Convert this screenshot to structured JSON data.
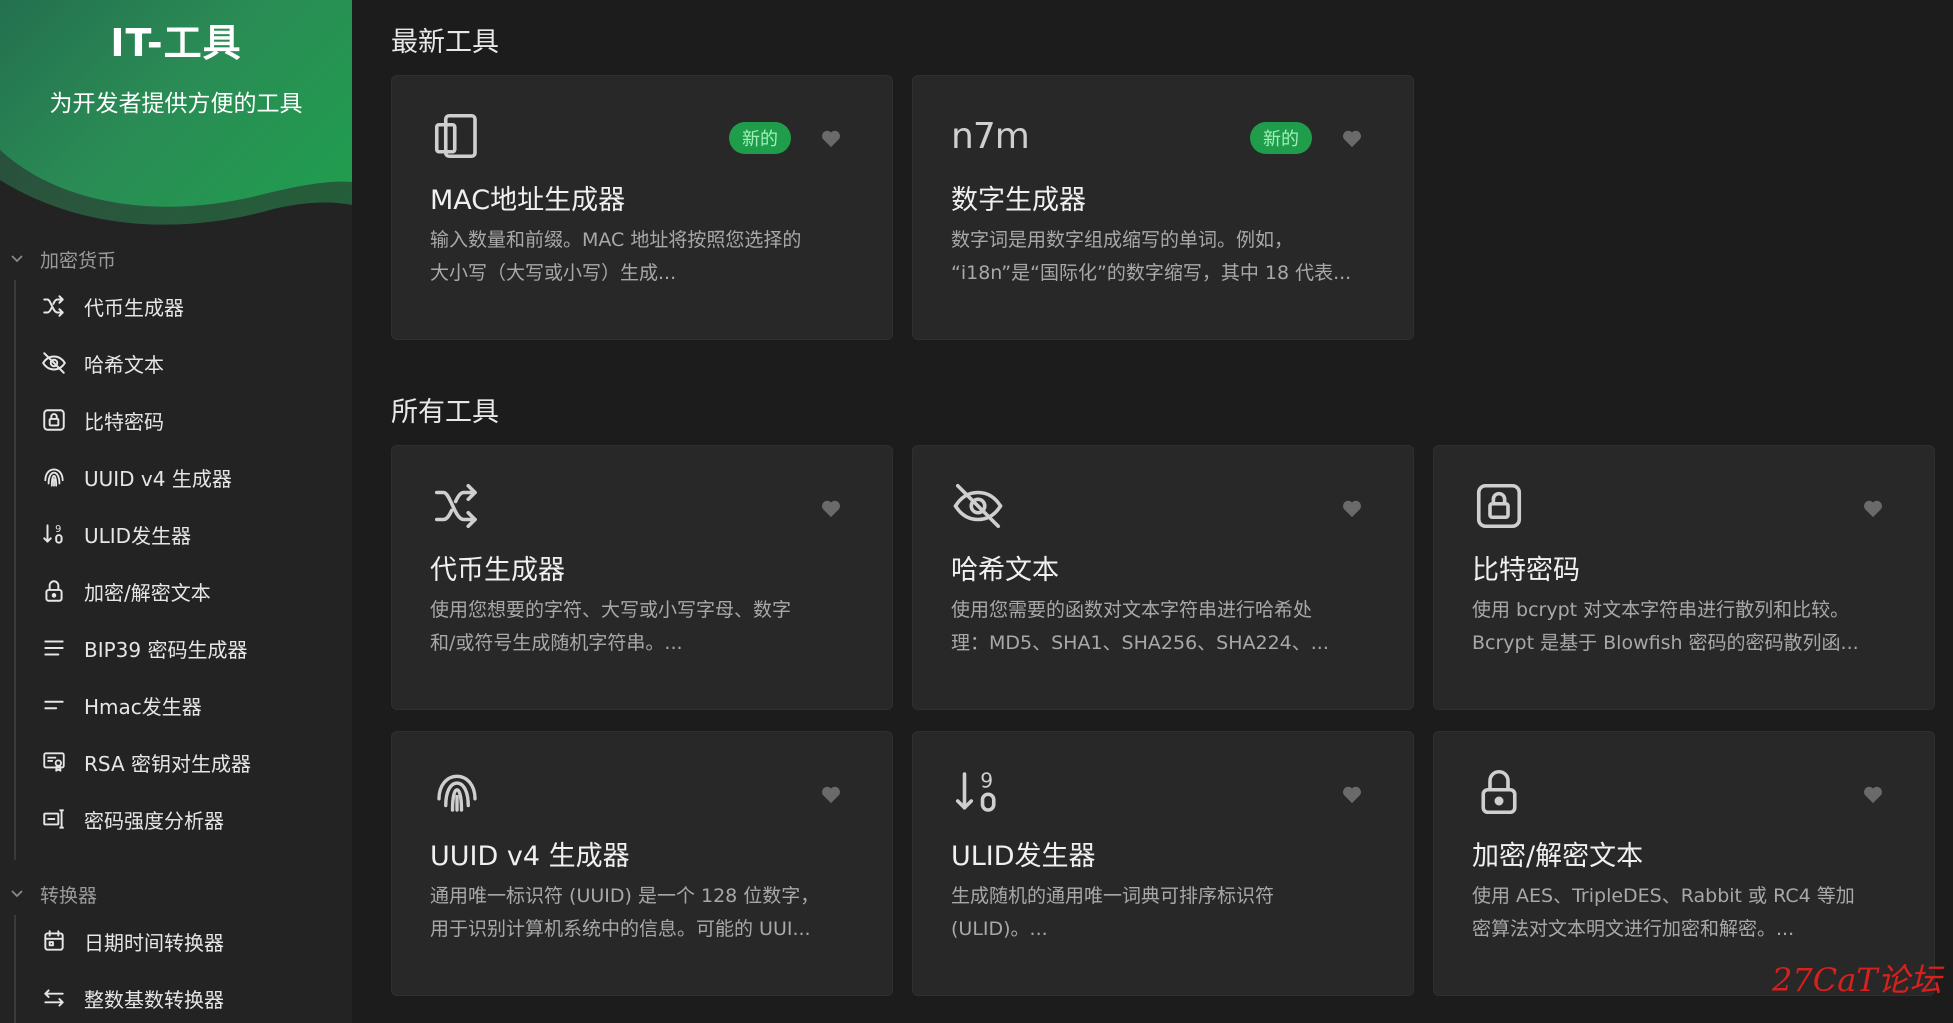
{
  "app": {
    "title": "IT-工具",
    "subtitle": "为开发者提供方便的工具"
  },
  "sidebar": {
    "groups": [
      {
        "label": "加密货币",
        "items": [
          {
            "label": "代币生成器",
            "icon": "shuffle-icon"
          },
          {
            "label": "哈希文本",
            "icon": "eye-off-icon"
          },
          {
            "label": "比特密码",
            "icon": "lock-square-icon"
          },
          {
            "label": "UUID v4 生成器",
            "icon": "fingerprint-icon"
          },
          {
            "label": "ULID发生器",
            "icon": "sort-numeric-icon"
          },
          {
            "label": "加密/解密文本",
            "icon": "lock-icon"
          },
          {
            "label": "BIP39 密码生成器",
            "icon": "list-icon"
          },
          {
            "label": "Hmac发生器",
            "icon": "short-text-icon"
          },
          {
            "label": "RSA 密钥对生成器",
            "icon": "certificate-icon"
          },
          {
            "label": "密码强度分析器",
            "icon": "password-icon"
          }
        ]
      },
      {
        "label": "转换器",
        "items": [
          {
            "label": "日期时间转换器",
            "icon": "calendar-icon"
          },
          {
            "label": "整数基数转换器",
            "icon": "arrows-exchange-icon"
          }
        ]
      }
    ]
  },
  "sections": {
    "latest": {
      "title": "最新工具",
      "cards": [
        {
          "title": "MAC地址生成器",
          "badge": "新的",
          "icon": "devices-icon",
          "desc": [
            "输入数量和前缀。MAC 地址将按照您选择的",
            "大小写（大写或小写）生成..."
          ]
        },
        {
          "title": "数字生成器",
          "badge": "新的",
          "icon": "n7m-icon",
          "icon_text": "n7m",
          "desc": [
            "数字词是用数字组成缩写的单词。例如，",
            "“i18n”是“国际化”的数字缩写，其中 18 代表..."
          ]
        }
      ]
    },
    "all": {
      "title": "所有工具",
      "cards": [
        {
          "title": "代币生成器",
          "icon": "shuffle-icon",
          "desc": [
            "使用您想要的字符、大写或小写字母、数字",
            "和/或符号生成随机字符串。..."
          ]
        },
        {
          "title": "哈希文本",
          "icon": "eye-off-icon",
          "desc": [
            "使用您需要的函数对文本字符串进行哈希处",
            "理：MD5、SHA1、SHA256、SHA224、..."
          ]
        },
        {
          "title": "比特密码",
          "icon": "lock-square-icon",
          "desc": [
            "使用 bcrypt 对文本字符串进行散列和比较。",
            "Bcrypt 是基于 Blowfish 密码的密码散列函..."
          ]
        },
        {
          "title": "UUID v4 生成器",
          "icon": "fingerprint-icon",
          "desc": [
            "通用唯一标识符 (UUID) 是一个 128 位数字，",
            "用于识别计算机系统中的信息。可能的 UUI..."
          ]
        },
        {
          "title": "ULID发生器",
          "icon": "sort-numeric-icon",
          "desc": [
            "生成随机的通用唯一词典可排序标识符",
            "(ULID)。..."
          ]
        },
        {
          "title": "加密/解密文本",
          "icon": "lock-icon",
          "desc": [
            "使用 AES、TripleDES、Rabbit 或 RC4 等加",
            "密算法对文本明文进行加密和解密。..."
          ]
        }
      ]
    }
  },
  "watermark": "27CaT论坛",
  "colors": {
    "accent": "#1f9d4a",
    "badge_text": "#9ff0b9",
    "background": "#1c1c1c",
    "card": "#282828",
    "sidebar": "#232323"
  }
}
